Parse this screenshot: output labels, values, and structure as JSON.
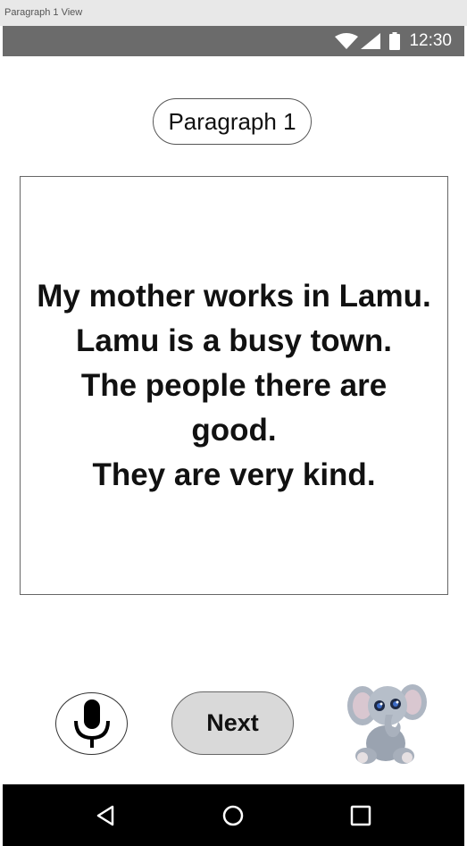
{
  "window": {
    "title": "Paragraph 1 View"
  },
  "status_bar": {
    "time": "12:30",
    "icons": [
      "wifi-icon",
      "signal-icon",
      "battery-icon"
    ]
  },
  "header": {
    "title": "Paragraph 1"
  },
  "paragraph": {
    "lines": [
      "My mother works in Lamu.",
      "Lamu is a busy town.",
      "The people there are",
      "good.",
      "They are very kind."
    ]
  },
  "controls": {
    "next_label": "Next",
    "mic_icon": "microphone-icon",
    "mascot_icon": "elephant-mascot"
  },
  "nav": {
    "icons": [
      "back-icon",
      "home-icon",
      "recents-icon"
    ]
  },
  "colors": {
    "status_bar": "#6b6b6b",
    "next_button": "#d9d9d9",
    "nav_bar": "#000000"
  }
}
